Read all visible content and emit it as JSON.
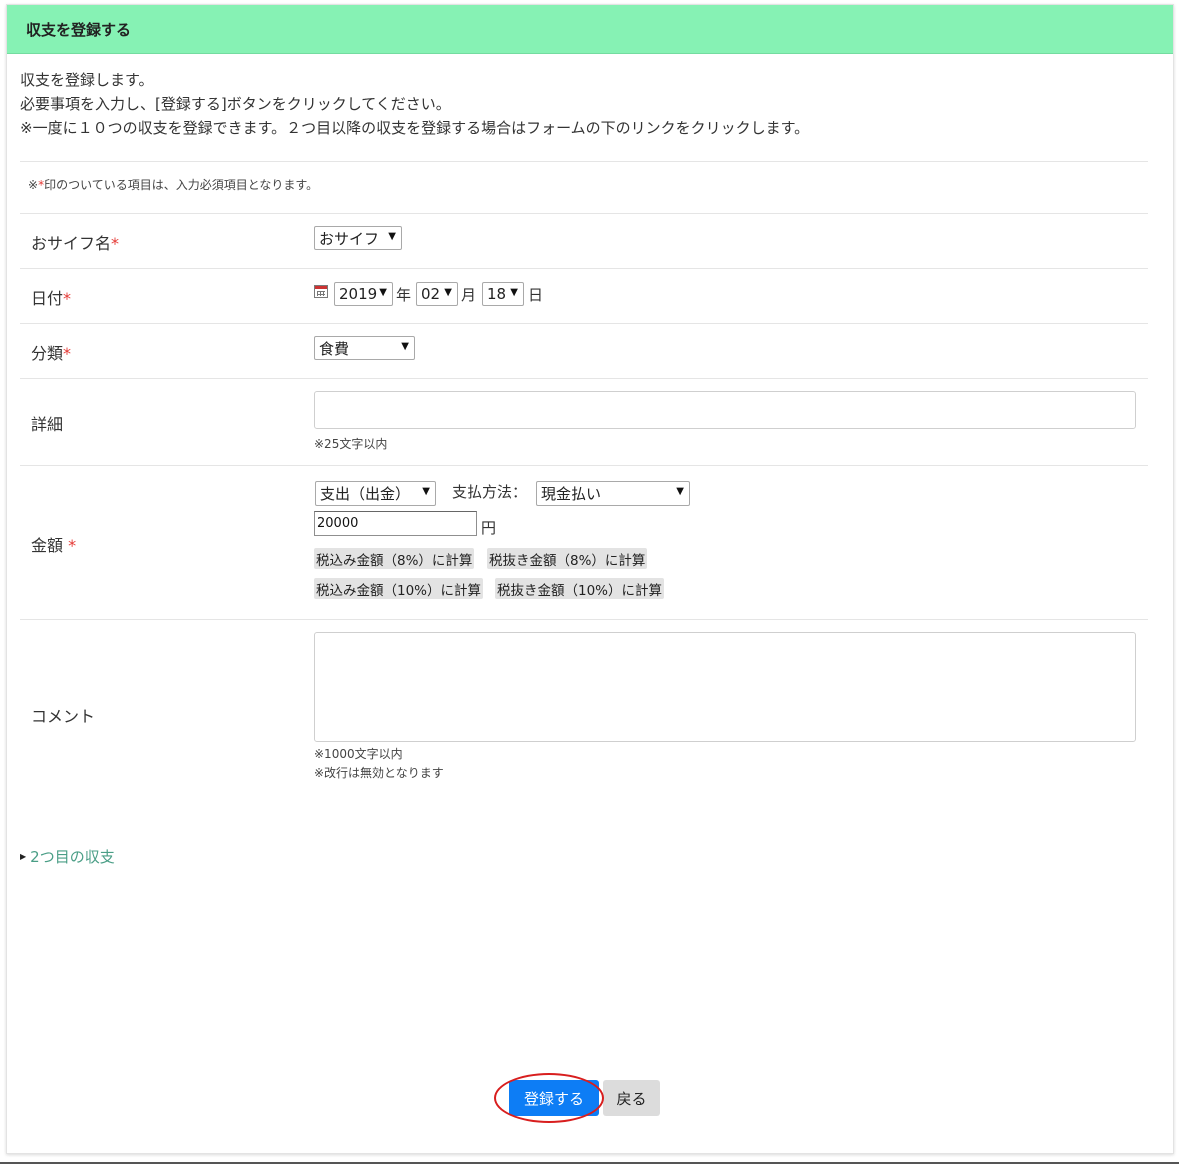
{
  "header": {
    "title": "収支を登録する"
  },
  "intro": {
    "line1": "収支を登録します。",
    "line2": "必要事項を入力し、[登録する]ボタンをクリックしてください。",
    "line3": "※一度に１０つの収支を登録できます。２つ目以降の収支を登録する場合はフォームの下のリンクをクリックします。"
  },
  "required_note": {
    "prefix": "※",
    "mark": "*",
    "suffix": "印のついている項目は、入力必須項目となります。"
  },
  "form": {
    "wallet": {
      "label": "おサイフ名",
      "required_mark": "*",
      "value": "おサイフ"
    },
    "date": {
      "label": "日付",
      "required_mark": "*",
      "year": "2019",
      "year_unit": "年",
      "month": "02",
      "month_unit": "月",
      "day": "18",
      "day_unit": "日"
    },
    "category": {
      "label": "分類",
      "required_mark": "*",
      "value": "食費"
    },
    "detail": {
      "label": "詳細",
      "value": "",
      "hint": "※25文字以内"
    },
    "amount": {
      "label": "金額",
      "required_mark": "*",
      "type_value": "支出（出金）",
      "payment_label": "支払方法：",
      "payment_value": "現金払い",
      "value": "20000",
      "unit": "円",
      "calc_buttons": [
        "税込み金額（8%）に計算",
        "税抜き金額（8%）に計算",
        "税込み金額（10%）に計算",
        "税抜き金額（10%）に計算"
      ]
    },
    "comment": {
      "label": "コメント",
      "value": "",
      "hint1": "※1000文字以内",
      "hint2": "※改行は無効となります"
    }
  },
  "more_link": {
    "label": "2つ目の収支"
  },
  "actions": {
    "submit_label": "登録する",
    "back_label": "戻る"
  },
  "colors": {
    "header_bg": "#86f2b4",
    "primary": "#0d7df5",
    "link": "#4a9e86",
    "required": "#e53935",
    "highlight_circle": "#d81e1e"
  }
}
